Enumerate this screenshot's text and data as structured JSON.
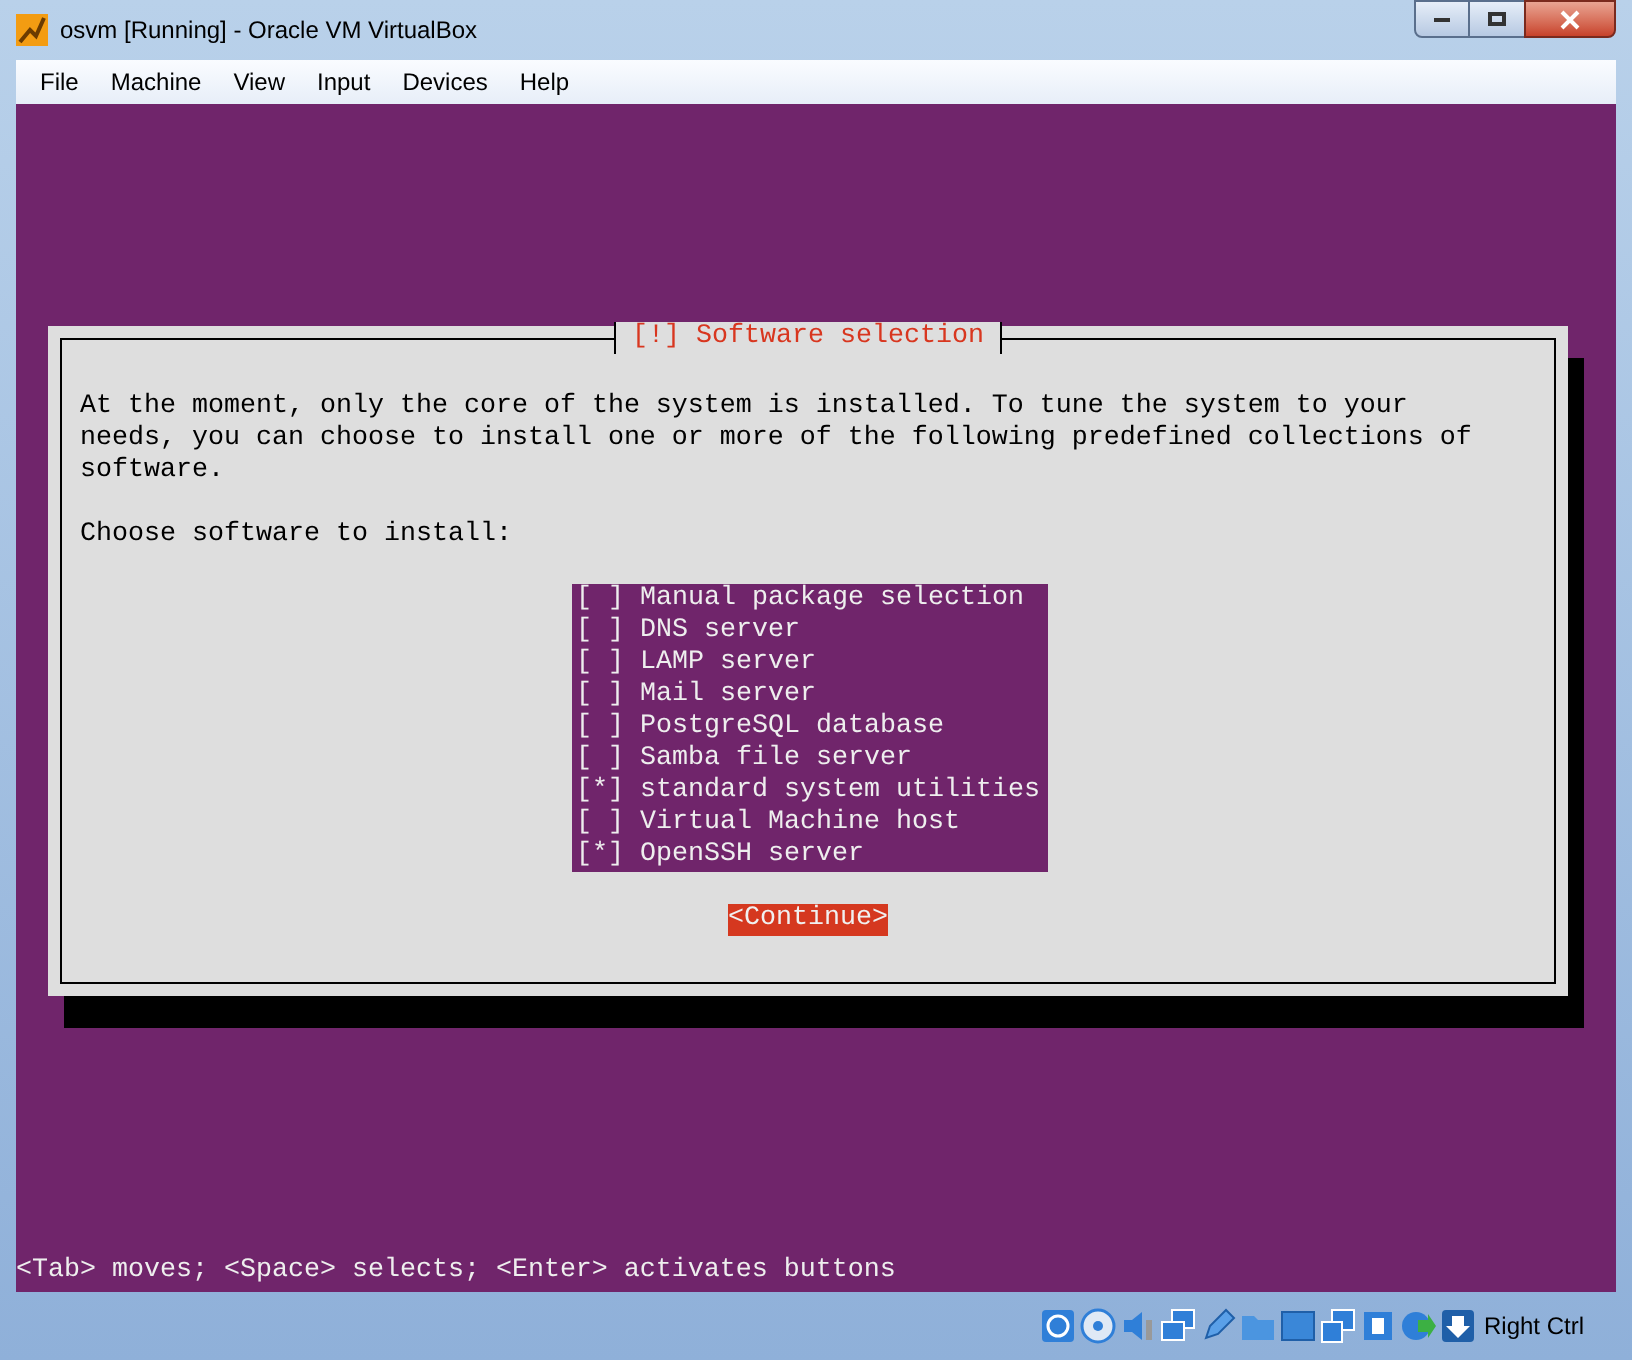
{
  "window": {
    "title": "osvm [Running] - Oracle VM VirtualBox"
  },
  "menu": [
    "File",
    "Machine",
    "View",
    "Input",
    "Devices",
    "Help"
  ],
  "dialog": {
    "title": "[!] Software selection",
    "message": "At the moment, only the core of the system is installed. To tune the system to your needs, you can choose to install one or more of the following predefined collections of software.",
    "prompt": "Choose software to install:",
    "checkbox_marks": {
      "left": "[",
      "right": "]",
      "tick": "*"
    },
    "items": [
      {
        "label": "Manual package selection",
        "checked": false
      },
      {
        "label": "DNS server",
        "checked": false
      },
      {
        "label": "LAMP server",
        "checked": false
      },
      {
        "label": "Mail server",
        "checked": false
      },
      {
        "label": "PostgreSQL database",
        "checked": false
      },
      {
        "label": "Samba file server",
        "checked": false
      },
      {
        "label": "standard system utilities",
        "checked": true
      },
      {
        "label": "Virtual Machine host",
        "checked": false
      },
      {
        "label": "OpenSSH server",
        "checked": true
      }
    ],
    "button": "<Continue>"
  },
  "help_line": "<Tab> moves; <Space> selects; <Enter> activates buttons",
  "status_bar": {
    "indicators": [
      {
        "kind": "disk"
      },
      {
        "kind": "cd"
      },
      {
        "kind": "audio"
      },
      {
        "kind": "network"
      },
      {
        "kind": "usb"
      },
      {
        "kind": "folder"
      },
      {
        "kind": "display"
      },
      {
        "kind": "seamless"
      },
      {
        "kind": "chip"
      },
      {
        "kind": "globe"
      },
      {
        "kind": "arrow"
      }
    ],
    "host_key": "Right Ctrl"
  }
}
